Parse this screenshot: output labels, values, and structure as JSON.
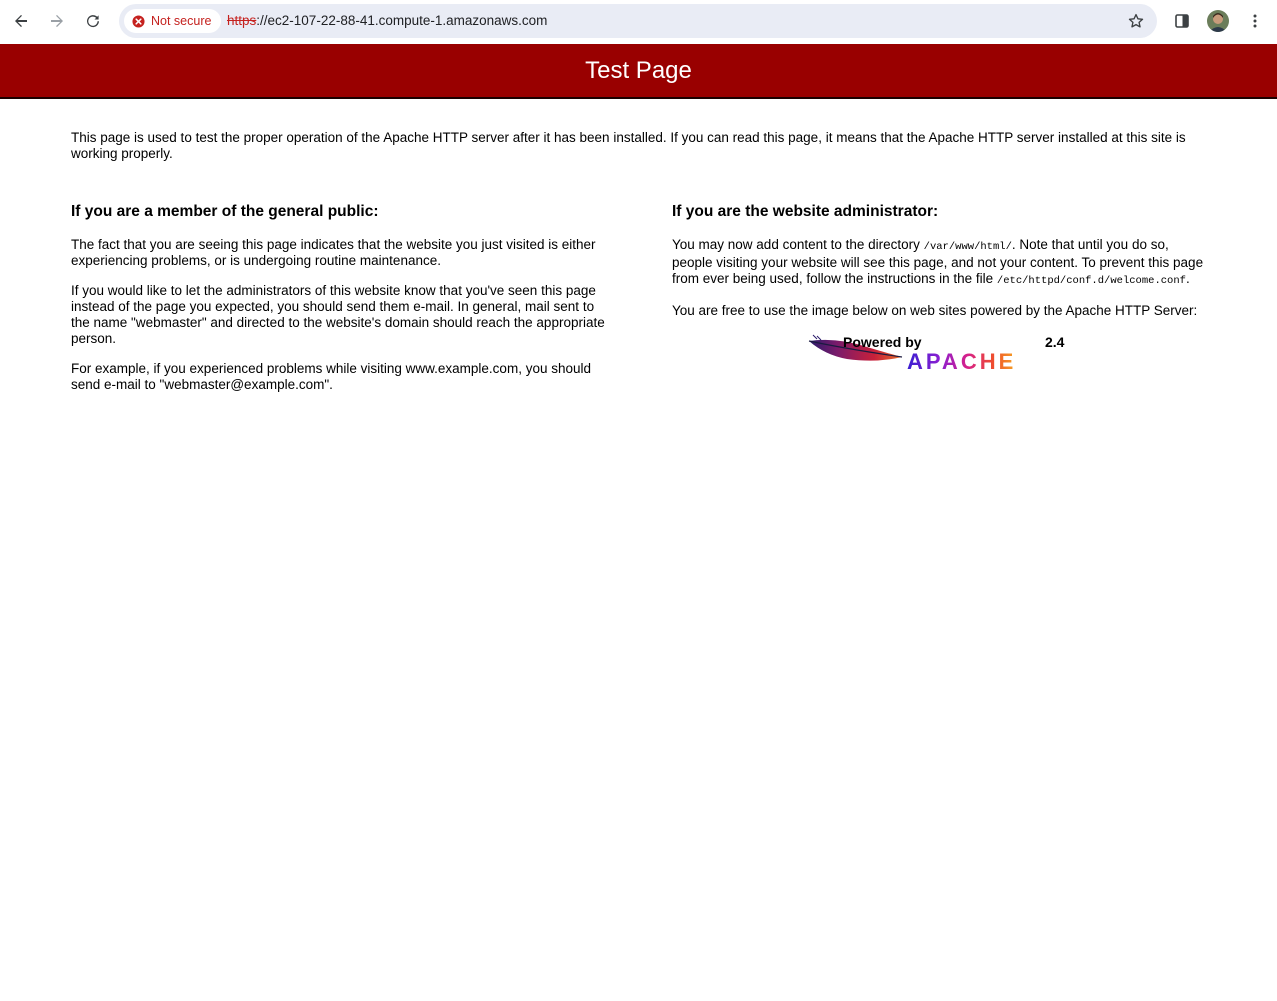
{
  "browser": {
    "security_label": "Not secure",
    "url_scheme": "https",
    "url_rest": "://ec2-107-22-88-41.compute-1.amazonaws.com",
    "icons": [
      "back-icon",
      "forward-icon",
      "reload-icon",
      "error-icon",
      "star-icon",
      "side-panel-icon",
      "avatar",
      "more-vert-icon"
    ]
  },
  "page": {
    "title": "Test Page",
    "intro": "This page is used to test the proper operation of the Apache HTTP server after it has been installed. If you can read this page, it means that the Apache HTTP server installed at this site is working properly.",
    "public": {
      "heading": "If you are a member of the general public:",
      "p1": "The fact that you are seeing this page indicates that the website you just visited is either experiencing problems, or is undergoing routine maintenance.",
      "p2": "If you would like to let the administrators of this website know that you've seen this page instead of the page you expected, you should send them e-mail. In general, mail sent to the name \"webmaster\" and directed to the website's domain should reach the appropriate person.",
      "p3": "For example, if you experienced problems while visiting www.example.com, you should send e-mail to \"webmaster@example.com\"."
    },
    "admin": {
      "heading": "If you are the website administrator:",
      "p1_a": "You may now add content to the directory ",
      "p1_dir": "/var/www/html/",
      "p1_b": ". Note that until you do so, people visiting your website will see this page, and not your content. To prevent this page from ever being used, follow the instructions in the file ",
      "p1_file": "/etc/httpd/conf.d/welcome.conf",
      "p1_c": ".",
      "p2": "You are free to use the image below on web sites powered by the Apache HTTP Server:"
    },
    "logo": {
      "powered_by": "Powered by",
      "version": "2.4",
      "name": "APACHE"
    }
  },
  "colors": {
    "banner": "#990000",
    "not_secure": "#c5221f",
    "omnibox": "#e9ecf5"
  }
}
